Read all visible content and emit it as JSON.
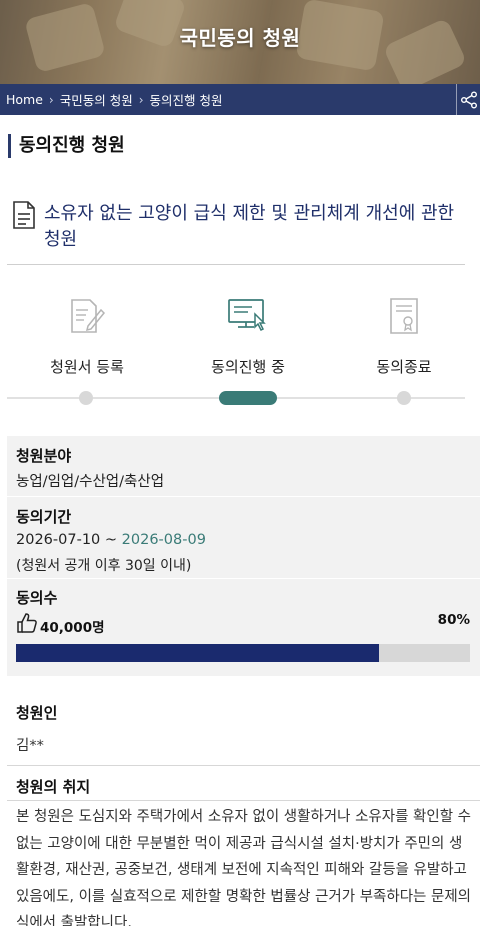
{
  "header": {
    "title": "국민동의 청원"
  },
  "breadcrumb": {
    "items": [
      "Home",
      "국민동의 청원",
      "동의진행 청원"
    ],
    "separator": "›"
  },
  "section": {
    "heading": "동의진행 청원"
  },
  "petition": {
    "title": "소유자 없는 고양이 급식 제한 및 관리체계 개선에 관한 청원"
  },
  "steps": {
    "items": [
      {
        "label": "청원서 등록",
        "icon": "document-edit-icon",
        "state": "done"
      },
      {
        "label": "동의진행 중",
        "icon": "computer-click-icon",
        "state": "active"
      },
      {
        "label": "동의종료",
        "icon": "certificate-icon",
        "state": "pending"
      }
    ],
    "accent": "#3a7b77"
  },
  "info": {
    "field_label": "청원분야",
    "field_value": "농업/임업/수산업/축산업",
    "period_label": "동의기간",
    "period_start": "2026-07-10",
    "period_sep": " ~ ",
    "period_end": "2026-08-09",
    "period_note": "(청원서 공개 이후 30일 이내)",
    "count_label": "동의수",
    "count_value": "40,000명",
    "percent_text": "80%",
    "progress": 0.8,
    "progress_color": "#1a2a6e"
  },
  "petitioner": {
    "label": "청원인",
    "value": "김**"
  },
  "purpose": {
    "label": "청원의 취지",
    "text": "본 청원은 도심지와 주택가에서 소유자 없이 생활하거나 소유자를 확인할 수 없는 고양이에 대한 무분별한 먹이 제공과 급식시설 설치·방치가 주민의 생활환경, 재산권, 공중보건, 생태계 보전에 지속적인 피해와 갈등을 유발하고 있음에도, 이를 실효적으로 제한할 명확한 법률상 근거가 부족하다는 문제의식에서 출발합니다."
  },
  "colors": {
    "navy": "#2a3a6b",
    "teal": "#3a7b77"
  }
}
